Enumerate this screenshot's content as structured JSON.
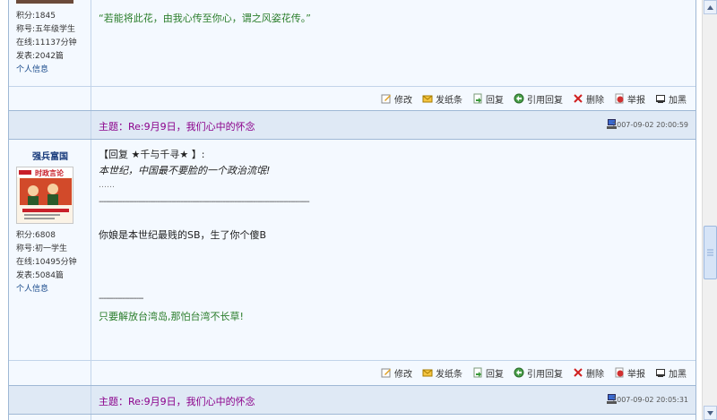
{
  "post1": {
    "info": {
      "points": "积分:1845",
      "title": "称号:五年级学生",
      "online": "在线:11137分钟",
      "posts": "发表:2042篇",
      "profile": "个人信息"
    },
    "dash_top": "-------------------",
    "signature": "“若能将此花，由我心传至你心，谓之风姿花传。”"
  },
  "toolbar": {
    "edit": "修改",
    "message": "发纸条",
    "reply": "回复",
    "quote": "引用回复",
    "delete": "删除",
    "report": "举报",
    "bold": "加黑"
  },
  "post2": {
    "subject_label": "主题",
    "subject": "：Re:9月9日，我们心中的怀念",
    "time": "2007-09-02 20:00:59",
    "username": "强兵富国",
    "avatar_text": "时政言论",
    "info": {
      "points": "积分:6808",
      "title": "称号:初一学生",
      "online": "在线:10495分钟",
      "posts": "发表:5084篇",
      "profile": "个人信息"
    },
    "quote_header": "【回复 ★千与千寻★ 】:",
    "quote_body": "本世纪，中国最不要脸的一个政治流氓!",
    "ellipsis": "……",
    "dash_line": "------------------------------------------------------------------------------------------",
    "body": "你娘是本世纪最贱的SB，生了你个傻B",
    "sig_dash": "-------------------",
    "signature": "只要解放台湾岛,那怕台湾不长草!"
  },
  "post3": {
    "subject_label": "主题",
    "subject": "：Re:9月9日，我们心中的怀念",
    "time": "2007-09-02 20:05:31"
  }
}
